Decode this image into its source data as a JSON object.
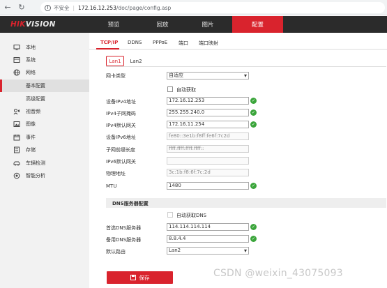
{
  "browser": {
    "back_icon": "arrow-left-icon",
    "reload_icon": "reload-icon",
    "security_text": "不安全",
    "url_host": "172.16.12.253",
    "url_path": "/doc/page/config.asp"
  },
  "header": {
    "logo_part1": "HIK",
    "logo_part2": "VISION",
    "nav": [
      {
        "label": "预览"
      },
      {
        "label": "回放"
      },
      {
        "label": "图片"
      },
      {
        "label": "配置",
        "active": true
      }
    ],
    "accent_color": "#d9232d"
  },
  "sidebar": {
    "items": [
      {
        "label": "本地",
        "icon": "monitor-icon"
      },
      {
        "label": "系统",
        "icon": "system-icon"
      },
      {
        "label": "网络",
        "icon": "globe-icon"
      },
      {
        "label": "基本配置",
        "icon": "",
        "sub": true,
        "active": true
      },
      {
        "label": "高级配置",
        "icon": "",
        "sub": true
      },
      {
        "label": "视音频",
        "icon": "audio-video-icon"
      },
      {
        "label": "图像",
        "icon": "image-icon"
      },
      {
        "label": "事件",
        "icon": "calendar-icon"
      },
      {
        "label": "存储",
        "icon": "storage-icon"
      },
      {
        "label": "车辆检测",
        "icon": "car-icon"
      },
      {
        "label": "智能分析",
        "icon": "analysis-icon"
      }
    ]
  },
  "subtabs": [
    {
      "label": "TCP/IP",
      "active": true
    },
    {
      "label": "DDNS"
    },
    {
      "label": "PPPoE"
    },
    {
      "label": "端口"
    },
    {
      "label": "端口映射"
    }
  ],
  "lan_tabs": [
    {
      "label": "Lan1",
      "active": true
    },
    {
      "label": "Lan2"
    }
  ],
  "form": {
    "nic_type_label": "网卡类型",
    "nic_type_value": "自适应",
    "auto_get_label": "自动获取",
    "ipv4_addr_label": "设备IPv4地址",
    "ipv4_addr_value": "172.16.12.253",
    "ipv4_mask_label": "IPv4子网掩码",
    "ipv4_mask_value": "255.255.240.0",
    "ipv4_gw_label": "IPv4默认网关",
    "ipv4_gw_value": "172.16.11.254",
    "ipv6_addr_label": "设备IPv6地址",
    "ipv6_addr_value": "fe80::3e1b:f8ff:fe6f:7c2d",
    "prefix_label": "子网前缀长度",
    "prefix_value": "ffff:ffff:ffff:ffff::",
    "ipv6_gw_label": "IPv6默认网关",
    "ipv6_gw_value": "",
    "mac_label": "物理地址",
    "mac_value": "3c:1b:f8:6f:7c:2d",
    "mtu_label": "MTU",
    "mtu_value": "1480"
  },
  "dns": {
    "section_title": "DNS服务器配置",
    "auto_dns_label": "自动获取DNS",
    "primary_label": "首选DNS服务器",
    "primary_value": "114.114.114.114",
    "secondary_label": "备用DNS服务器",
    "secondary_value": "8.8.4.4",
    "default_route_label": "默认路由",
    "default_route_value": "Lan2"
  },
  "save_label": "保存",
  "watermark": "CSDN @weixin_43075093",
  "status_ok_color": "#3ba53b"
}
